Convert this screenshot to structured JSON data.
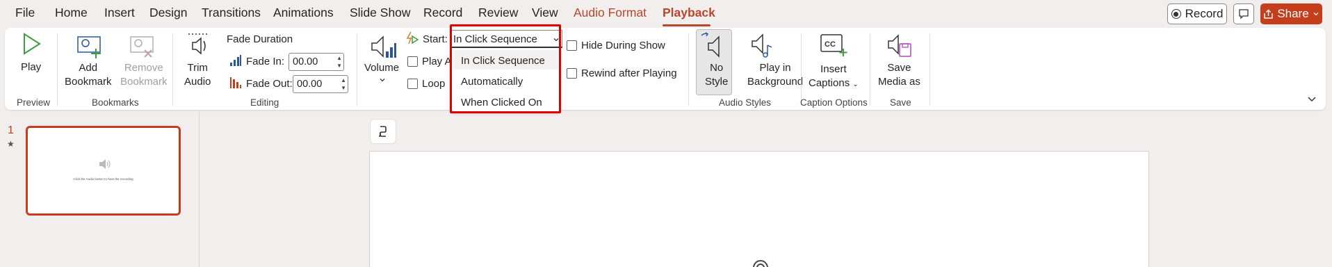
{
  "menu": {
    "tabs": [
      {
        "label": "File"
      },
      {
        "label": "Home"
      },
      {
        "label": "Insert"
      },
      {
        "label": "Design"
      },
      {
        "label": "Transitions"
      },
      {
        "label": "Animations"
      },
      {
        "label": "Slide Show"
      },
      {
        "label": "Record"
      },
      {
        "label": "Review"
      },
      {
        "label": "View"
      },
      {
        "label": "Audio Format"
      },
      {
        "label": "Playback"
      }
    ],
    "active_tab": "Playback",
    "record_button": "Record",
    "share_button": "Share"
  },
  "ribbon": {
    "preview": {
      "play": "Play",
      "group": "Preview"
    },
    "bookmarks": {
      "add_line1": "Add",
      "add_line2": "Bookmark",
      "remove_line1": "Remove",
      "remove_line2": "Bookmark",
      "group": "Bookmarks"
    },
    "editing": {
      "trim_line1": "Trim",
      "trim_line2": "Audio",
      "fade_duration": "Fade Duration",
      "fade_in_label": "Fade In:",
      "fade_in_value": "00.00",
      "fade_out_label": "Fade Out:",
      "fade_out_value": "00.00",
      "group": "Editing"
    },
    "audio_options": {
      "volume": "Volume",
      "start_label": "Start:",
      "start_value": "In Click Sequence",
      "start_options": [
        "In Click Sequence",
        "Automatically",
        "When Clicked On"
      ],
      "play_across": "Play A",
      "loop": "Loop",
      "hide_during_show": "Hide During Show",
      "rewind_after_playing": "Rewind after Playing"
    },
    "audio_styles": {
      "no_style_line1": "No",
      "no_style_line2": "Style",
      "play_bg_line1": "Play in",
      "play_bg_line2": "Background",
      "group": "Audio Styles"
    },
    "caption_options": {
      "insert_line1": "Insert",
      "insert_line2": "Captions",
      "group": "Caption Options"
    },
    "save": {
      "line1": "Save",
      "line2": "Media as",
      "group": "Save"
    }
  },
  "thumbnails": [
    {
      "number": "1",
      "star": "★",
      "caption": "Click the Audio button to hear the recording"
    }
  ],
  "colors": {
    "accent": "#b7472a",
    "share": "#c43e1c",
    "highlight_frame": "#e00000"
  }
}
